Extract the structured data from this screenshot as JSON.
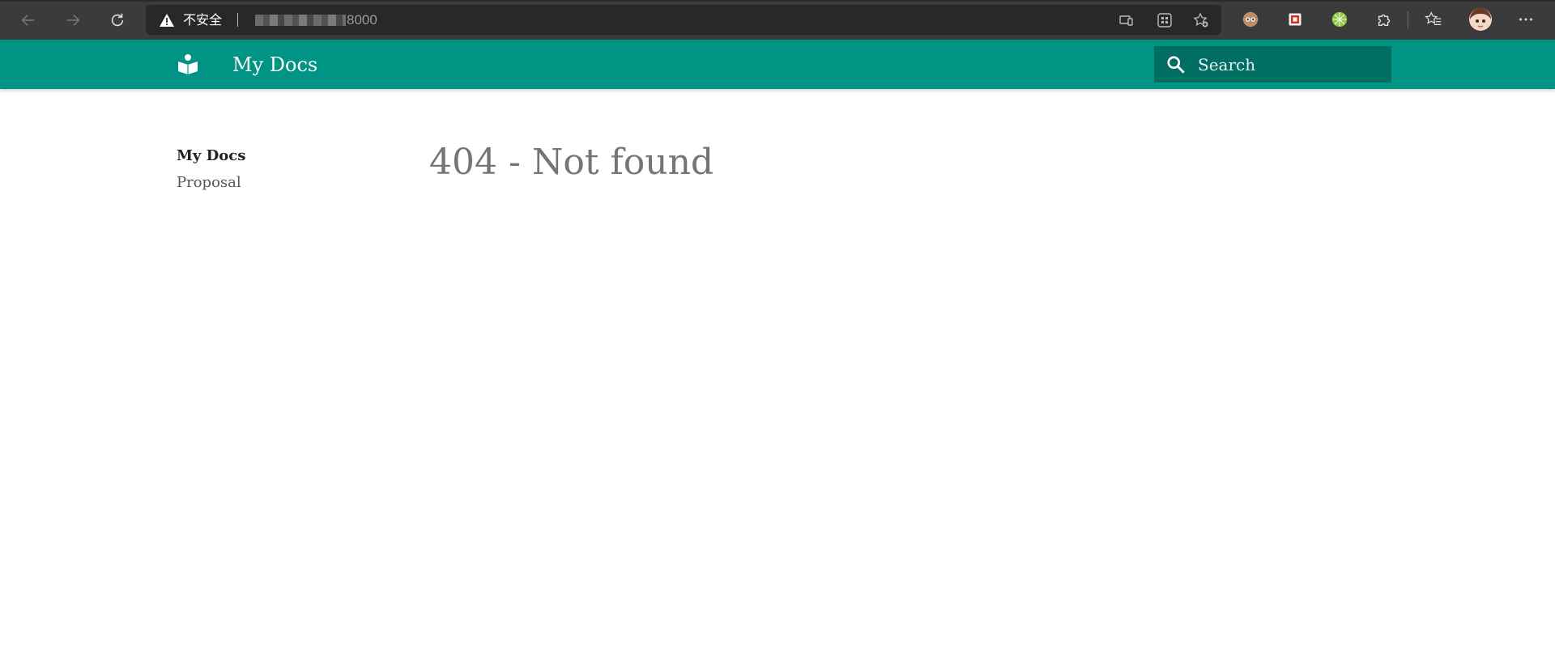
{
  "browser": {
    "security_label": "不安全",
    "url_port": "8000",
    "back_icon": "arrow-left-icon",
    "forward_icon": "arrow-right-icon",
    "refresh_icon": "refresh-icon",
    "chrome_color": "#3b3b3b"
  },
  "header": {
    "title": "My Docs",
    "logo_icon": "book-reader-icon",
    "search": {
      "placeholder": "Search"
    },
    "color": "#009485"
  },
  "sidebar": {
    "title": "My Docs",
    "items": [
      {
        "label": "Proposal"
      }
    ]
  },
  "main": {
    "heading": "404 - Not found"
  }
}
